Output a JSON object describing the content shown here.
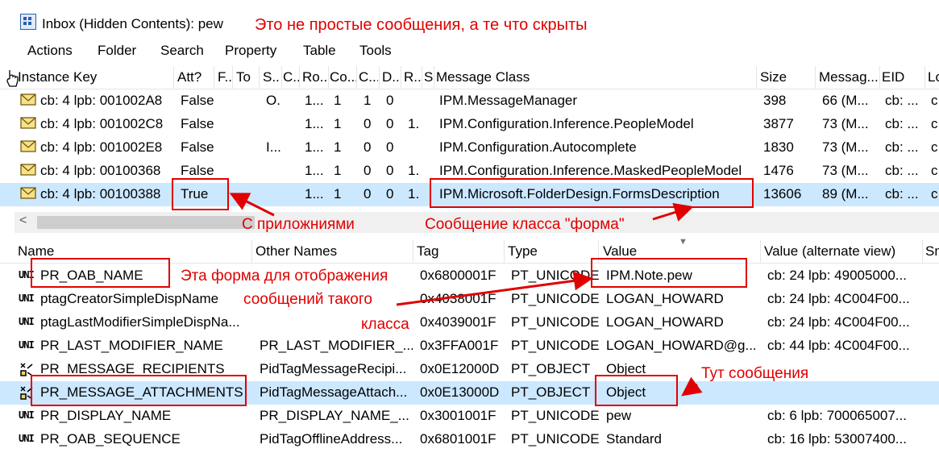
{
  "window": {
    "title": "Inbox (Hidden Contents): pew"
  },
  "menu": [
    "Actions",
    "Folder",
    "Search",
    "Property",
    "Table",
    "Tools"
  ],
  "upper_table": {
    "columns": [
      "Instance Key",
      "Att?",
      "F...",
      "To",
      "S...",
      "C...",
      "Ro...",
      "Co...",
      "C...",
      "D...",
      "R...",
      "S",
      "Message Class",
      "Size",
      "Messag...",
      "EID",
      "Lo"
    ],
    "rows": [
      {
        "key": "cb: 4 lpb: 001002A8",
        "att": "False",
        "s": "O.",
        "ro": "1...",
        "co": "1",
        "c": "1",
        "d": "0",
        "r": "",
        "msgclass": "IPM.MessageManager",
        "size": "398",
        "message": "66 (M...",
        "eid": "cb: ...",
        "lo": "c"
      },
      {
        "key": "cb: 4 lpb: 001002C8",
        "att": "False",
        "s": "",
        "ro": "1...",
        "co": "1",
        "c": "0",
        "d": "0",
        "r": "1.",
        "msgclass": "IPM.Configuration.Inference.PeopleModel",
        "size": "3877",
        "message": "73 (M...",
        "eid": "cb: ...",
        "lo": "c"
      },
      {
        "key": "cb: 4 lpb: 001002E8",
        "att": "False",
        "s": "I...",
        "ro": "1...",
        "co": "1",
        "c": "0",
        "d": "0",
        "r": "",
        "msgclass": "IPM.Configuration.Autocomplete",
        "size": "1830",
        "message": "73 (M...",
        "eid": "cb: ...",
        "lo": "c"
      },
      {
        "key": "cb: 4 lpb: 00100368",
        "att": "False",
        "s": "",
        "ro": "1...",
        "co": "1",
        "c": "0",
        "d": "0",
        "r": "1.",
        "msgclass": "IPM.Configuration.Inference.MaskedPeopleModel",
        "size": "1476",
        "message": "73 (M...",
        "eid": "cb: ...",
        "lo": "c"
      },
      {
        "key": "cb: 4 lpb: 00100388",
        "att": "True",
        "s": "",
        "ro": "1...",
        "co": "1",
        "c": "0",
        "d": "0",
        "r": "1.",
        "msgclass": "IPM.Microsoft.FolderDesign.FormsDescription",
        "size": "13606",
        "message": "89 (M...",
        "eid": "cb: ...",
        "lo": "c"
      }
    ]
  },
  "lower_table": {
    "columns": [
      "Name",
      "Other Names",
      "Tag",
      "Type",
      "Value",
      "Value (alternate view)",
      "Sm"
    ],
    "rows": [
      {
        "icon": "UNI",
        "name": "PR_OAB_NAME",
        "other": "",
        "tag": "0x6800001F",
        "type": "PT_UNICODE",
        "value": "IPM.Note.pew",
        "alt": "cb: 24 lpb: 49005000..."
      },
      {
        "icon": "UNI",
        "name": "ptagCreatorSimpleDispName",
        "other": "",
        "tag": "0x4038001F",
        "type": "PT_UNICODE",
        "value": "LOGAN_HOWARD",
        "alt": "cb: 24 lpb: 4C004F00..."
      },
      {
        "icon": "UNI",
        "name": "ptagLastModifierSimpleDispNa...",
        "other": "",
        "tag": "0x4039001F",
        "type": "PT_UNICODE",
        "value": "LOGAN_HOWARD",
        "alt": "cb: 24 lpb: 4C004F00..."
      },
      {
        "icon": "UNI",
        "name": "PR_LAST_MODIFIER_NAME",
        "other": "PR_LAST_MODIFIER_...",
        "tag": "0x3FFA001F",
        "type": "PT_UNICODE",
        "value": "LOGAN_HOWARD@g...",
        "alt": "cb: 44 lpb: 4C004F00..."
      },
      {
        "icon": "OBJ",
        "name": "PR_MESSAGE_RECIPIENTS",
        "other": "PidTagMessageRecipi...",
        "tag": "0x0E12000D",
        "type": "PT_OBJECT",
        "value": "Object",
        "alt": ""
      },
      {
        "icon": "OBJ",
        "name": "PR_MESSAGE_ATTACHMENTS",
        "other": "PidTagMessageAttach...",
        "tag": "0x0E13000D",
        "type": "PT_OBJECT",
        "value": "Object",
        "alt": ""
      },
      {
        "icon": "UNI",
        "name": "PR_DISPLAY_NAME",
        "other": "PR_DISPLAY_NAME_...",
        "tag": "0x3001001F",
        "type": "PT_UNICODE",
        "value": "pew",
        "alt": "cb: 6 lpb: 700065007..."
      },
      {
        "icon": "UNI",
        "name": "PR_OAB_SEQUENCE",
        "other": "PidTagOfflineAddress...",
        "tag": "0x6801001F",
        "type": "PT_UNICODE",
        "value": "Standard",
        "alt": "cb: 16 lpb: 53007400..."
      }
    ]
  },
  "annotations": {
    "title_note": "Это не простые сообщения, а те что скрыты",
    "attachments_note": "С приложниями",
    "form_class_note": "Сообщение класса \"форма\"",
    "form_display_line1": "Эта форма для отображения",
    "form_display_line2": "сообщений такого",
    "form_display_line3": "класса",
    "messages_here": "Тут сообщения"
  },
  "colors": {
    "selection": "#cce8ff",
    "annotation_red": "#e00000"
  }
}
